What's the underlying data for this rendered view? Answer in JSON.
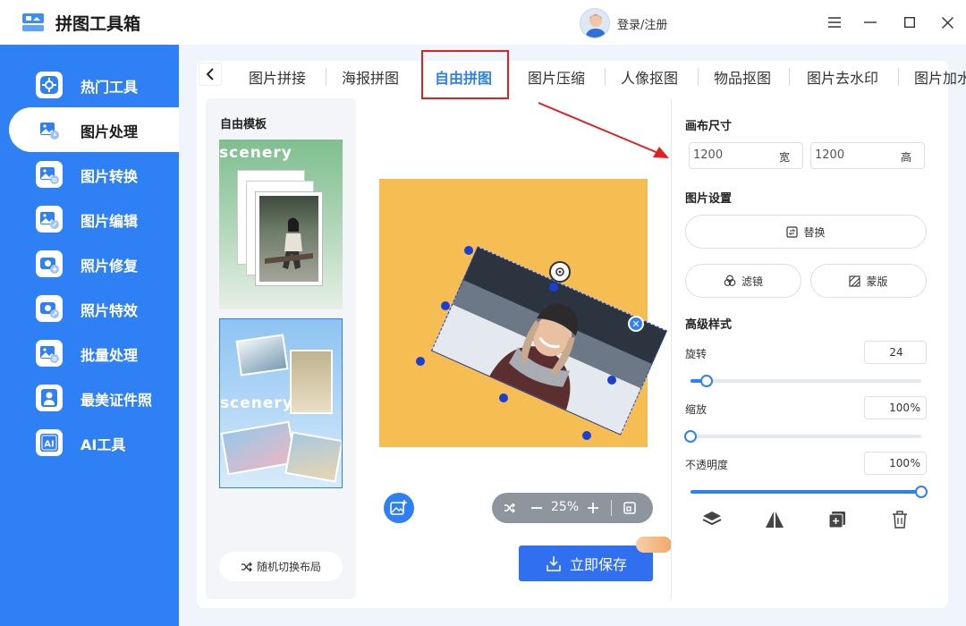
{
  "app": {
    "title": "拼图工具箱",
    "login_label": "登录/注册"
  },
  "sidebar": {
    "items": [
      {
        "label": "热门工具",
        "icon": "gear-tools-icon"
      },
      {
        "label": "图片处理",
        "icon": "image-process-icon",
        "active": true
      },
      {
        "label": "图片转换",
        "icon": "image-convert-icon"
      },
      {
        "label": "图片编辑",
        "icon": "image-edit-icon"
      },
      {
        "label": "照片修复",
        "icon": "camera-repair-icon"
      },
      {
        "label": "照片特效",
        "icon": "camera-effect-icon"
      },
      {
        "label": "批量处理",
        "icon": "batch-icon"
      },
      {
        "label": "最美证件照",
        "icon": "id-photo-icon"
      },
      {
        "label": "AI工具",
        "icon": "ai-icon"
      }
    ]
  },
  "tabs": [
    "图片拼接",
    "海报拼图",
    "自由拼图",
    "图片压缩",
    "人像抠图",
    "物品抠图",
    "图片去水印",
    "图片加水"
  ],
  "active_tab": "自由拼图",
  "templates": {
    "title": "自由模板",
    "card_text": "scenery",
    "random_label": "随机切换布局"
  },
  "canvas": {
    "background": "#f6bd52",
    "zoom": "25%"
  },
  "save_label": "立即保存",
  "right_panel": {
    "canvas_size_title": "画布尺寸",
    "width_value": "1200",
    "width_unit": "宽",
    "height_value": "1200",
    "height_unit": "高",
    "image_settings_title": "图片设置",
    "replace_label": "替换",
    "filter_label": "滤镜",
    "mask_label": "蒙版",
    "advanced_title": "高级样式",
    "rotate_label": "旋转",
    "rotate_value": "24",
    "rotate_level": 0.07,
    "scale_label": "缩放",
    "scale_value": "100",
    "scale_unit": "%",
    "scale_level": 0.0,
    "opacity_label": "不透明度",
    "opacity_value": "100",
    "opacity_unit": "%",
    "opacity_level": 1.0
  },
  "colors": {
    "accent": "#2f80f5",
    "sidebar": "#2f80f5",
    "highlight": "#e02020"
  }
}
